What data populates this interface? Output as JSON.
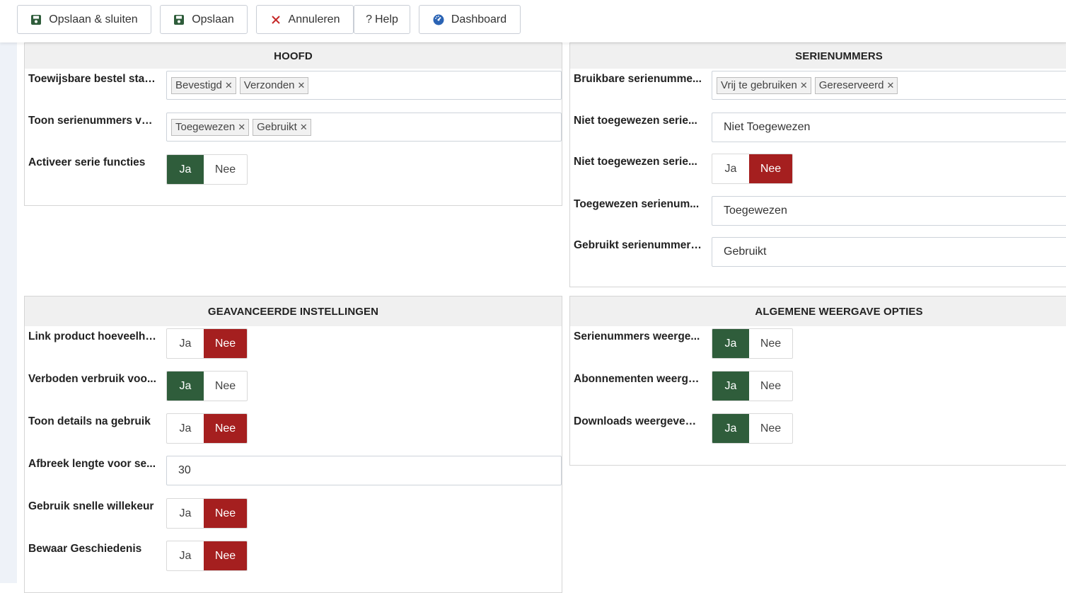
{
  "toolbar": {
    "save_close": "Opslaan & sluiten",
    "save": "Opslaan",
    "cancel": "Annuleren",
    "help": "Help",
    "dashboard": "Dashboard"
  },
  "colors": {
    "yes_active": "#2f5d3b",
    "no_active": "#a51f1f",
    "panel_header": "#f0f0f0"
  },
  "hoofd": {
    "title": "HOOFD",
    "row1_label": "Toewijsbare bestel stat...",
    "row1_chips": [
      "Bevestigd",
      "Verzonden"
    ],
    "row2_label": "Toon serienummers vo...",
    "row2_chips": [
      "Toegewezen",
      "Gebruikt"
    ],
    "row3_label": "Activeer serie functies",
    "row3_value": "Ja"
  },
  "serienummers": {
    "title": "SERIENUMMERS",
    "row1_label": "Bruikbare serienumme...",
    "row1_chips": [
      "Vrij te gebruiken",
      "Gereserveerd"
    ],
    "row2_label": "Niet toegewezen serie...",
    "row2_value": "Niet Toegewezen",
    "row3_label": "Niet toegewezen serie...",
    "row3_value": "Nee",
    "row4_label": "Toegewezen serienum...",
    "row4_value": "Toegewezen",
    "row5_label": "Gebruikt serienummer ...",
    "row5_value": "Gebruikt"
  },
  "geavanceerd": {
    "title": "GEAVANCEERDE INSTELLINGEN",
    "row1_label": "Link product hoeveelhe...",
    "row1_value": "Nee",
    "row2_label": "Verboden verbruik voo...",
    "row2_value": "Ja",
    "row3_label": "Toon details na gebruik",
    "row3_value": "Nee",
    "row4_label": "Afbreek lengte voor se...",
    "row4_value": "30",
    "row5_label": "Gebruik snelle willekeur",
    "row5_value": "Nee",
    "row6_label": "Bewaar Geschiedenis",
    "row6_value": "Nee"
  },
  "weergave": {
    "title": "ALGEMENE WEERGAVE OPTIES",
    "row1_label": "Serienummers weerge...",
    "row1_value": "Ja",
    "row2_label": "Abonnementen weerge...",
    "row2_value": "Ja",
    "row3_label": "Downloads weergeven ...",
    "row3_value": "Ja"
  },
  "toggle_labels": {
    "yes": "Ja",
    "no": "Nee"
  }
}
